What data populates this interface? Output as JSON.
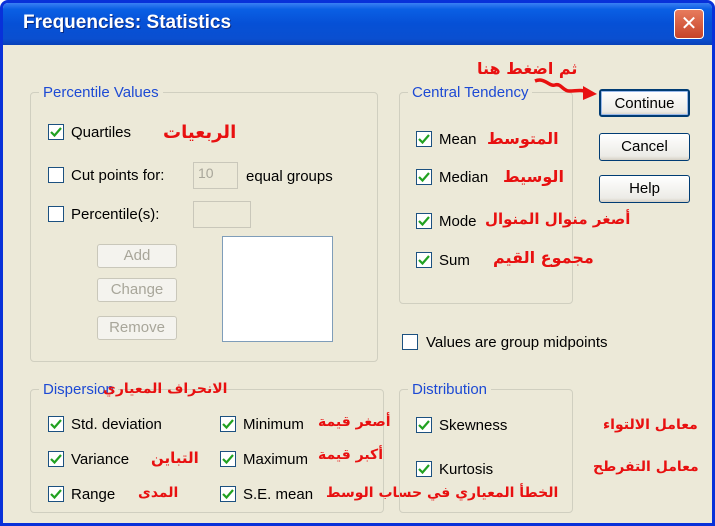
{
  "window": {
    "title": "Frequencies: Statistics",
    "close_glyph": "✕"
  },
  "percentile": {
    "title": "Percentile Values",
    "quartiles": {
      "label": "Quartiles",
      "checked": true,
      "ar": "الربعيات"
    },
    "cutpoints": {
      "label": "Cut points for:",
      "value": "10",
      "suffix": "equal groups",
      "checked": false
    },
    "percentiles": {
      "label": "Percentile(s):",
      "checked": false
    },
    "add": "Add",
    "change": "Change",
    "remove": "Remove"
  },
  "central": {
    "title": "Central Tendency",
    "mean": {
      "label": "Mean",
      "ar": "المتوسط",
      "checked": true
    },
    "median": {
      "label": "Median",
      "ar": "الوسيط",
      "checked": true
    },
    "mode": {
      "label": "Mode",
      "ar": "أصغر منوال المنوال",
      "checked": true
    },
    "sum": {
      "label": "Sum",
      "ar": "مجموع القيم",
      "checked": true
    }
  },
  "buttons": {
    "continue": "Continue",
    "cancel": "Cancel",
    "help": "Help",
    "annotation": "ثم اضغط هنا"
  },
  "midpoints": {
    "label": "Values are group midpoints",
    "checked": false
  },
  "dispersion": {
    "title": "Dispersion",
    "title_ar": "الانحراف المعياري",
    "std": {
      "label": "Std. deviation",
      "checked": true
    },
    "variance": {
      "label": "Variance",
      "ar": "التباين",
      "checked": true
    },
    "range": {
      "label": "Range",
      "ar": "المدى",
      "checked": true
    },
    "minimum": {
      "label": "Minimum",
      "ar": "أصغر قيمة",
      "checked": true
    },
    "maximum": {
      "label": "Maximum",
      "ar": "أكبر قيمة",
      "checked": true
    },
    "semean": {
      "label": "S.E. mean",
      "ar": "الخطأ المعياري في حساب الوسط",
      "checked": true
    }
  },
  "distribution": {
    "title": "Distribution",
    "skewness": {
      "label": "Skewness",
      "ar": "معامل الالتواء",
      "checked": true
    },
    "kurtosis": {
      "label": "Kurtosis",
      "ar": "معامل التفرطح",
      "checked": true
    }
  },
  "colors": {
    "title_bar": "#0a5fe4",
    "annotation": "#e81010",
    "group_title": "#1d4ad4",
    "check": "#21a121"
  },
  "icons": {
    "check": "check-icon",
    "close": "close-icon",
    "arrow": "arrow-icon"
  }
}
